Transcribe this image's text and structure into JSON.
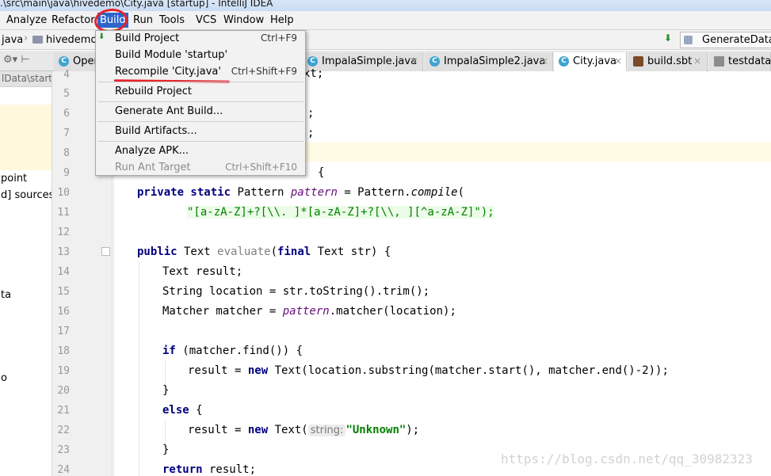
{
  "window_title": ".\\src\\main\\java\\hivedemo\\City.java [startup] - IntelliJ IDEA",
  "menu": {
    "analyze": "Analyze",
    "refactor": "Refactor",
    "build": "Build",
    "run": "Run",
    "tools": "Tools",
    "vcs": "VCS",
    "window": "Window",
    "help": "Help"
  },
  "nav": {
    "java": "java",
    "hivedemo": "hivedemo",
    "run_config": "GenerateData"
  },
  "tabs": [
    {
      "label": "Oper",
      "icon": "c-class-icon"
    },
    {
      "label": "ImpalaSimple.java",
      "icon": "c-class-icon"
    },
    {
      "label": "ImpalaSimple2.java",
      "icon": "c-class-icon"
    },
    {
      "label": "City.java",
      "icon": "c-class-icon",
      "active": true
    },
    {
      "label": "build.sbt",
      "icon": "sbt-file-icon"
    },
    {
      "label": "testdata.t",
      "icon": "text-file-icon"
    }
  ],
  "project_panel": {
    "header": "lData\\startU",
    "items": [
      "point",
      "d] sources r",
      "ta",
      "o"
    ]
  },
  "build_menu": {
    "items": [
      {
        "label": "Build Project",
        "shortcut": "Ctrl+F9",
        "enabled": true
      },
      {
        "label": "Build Module 'startup'",
        "shortcut": "",
        "enabled": true
      },
      {
        "label": "Recompile 'City.java'",
        "shortcut": "Ctrl+Shift+F9",
        "enabled": true
      },
      {
        "label": "Rebuild Project",
        "shortcut": "",
        "enabled": true
      },
      {
        "label": "Generate Ant Build...",
        "shortcut": "",
        "enabled": true
      },
      {
        "label": "Build Artifacts...",
        "shortcut": "",
        "enabled": true
      },
      {
        "label": "Analyze APK...",
        "shortcut": "",
        "enabled": true
      },
      {
        "label": "Run Ant Target",
        "shortcut": "Ctrl+Shift+F10",
        "enabled": false
      }
    ]
  },
  "editor": {
    "line_numbers": [
      "4",
      "5",
      "6",
      "7",
      "8",
      "9",
      "10",
      "11",
      "12",
      "13",
      "14",
      "15",
      "16",
      "17",
      "18",
      "19",
      "20",
      "21",
      "22",
      "23",
      "24"
    ],
    "frag_line4": "xt;",
    "frag_line6": ";",
    "frag_line7": ";",
    "frag_line9": "{",
    "line10": {
      "kw": "private static",
      "type": " Pattern ",
      "field": "pattern",
      "eq": " = Pattern.",
      "method": "compile",
      "paren": "("
    },
    "line11": "\"[a-zA-Z]+?[\\\\. ]*[a-zA-Z]+?[\\\\, ][^a-zA-Z]\");",
    "line13": {
      "kw": "public",
      "type": " Text ",
      "name": "evaluate",
      "open": "(",
      "kw2": "final",
      "rest": " Text str) {"
    },
    "line14": "Text result;",
    "line15": "String location = str.toString().trim();",
    "line16": {
      "pre": "Matcher matcher = ",
      "field": "pattern",
      "post": ".matcher(location);"
    },
    "line18": {
      "kw": "if",
      "rest": " (matcher.find()) {"
    },
    "line19": {
      "pre": "result = ",
      "kw": "new",
      "rest": " Text(location.substring(matcher.start(), matcher.end()-2));"
    },
    "line20": "}",
    "line21": {
      "kw": "else",
      "rest": " {"
    },
    "line22": {
      "pre": "result = ",
      "kw": "new",
      "mid": " Text(",
      "hint": "string:",
      "str": "\"Unknown\"",
      "post": ");"
    },
    "line23": "}",
    "line24": {
      "kw": "return",
      "rest": " result;"
    }
  },
  "watermark": "https://blog.csdn.net/qq_30982323"
}
